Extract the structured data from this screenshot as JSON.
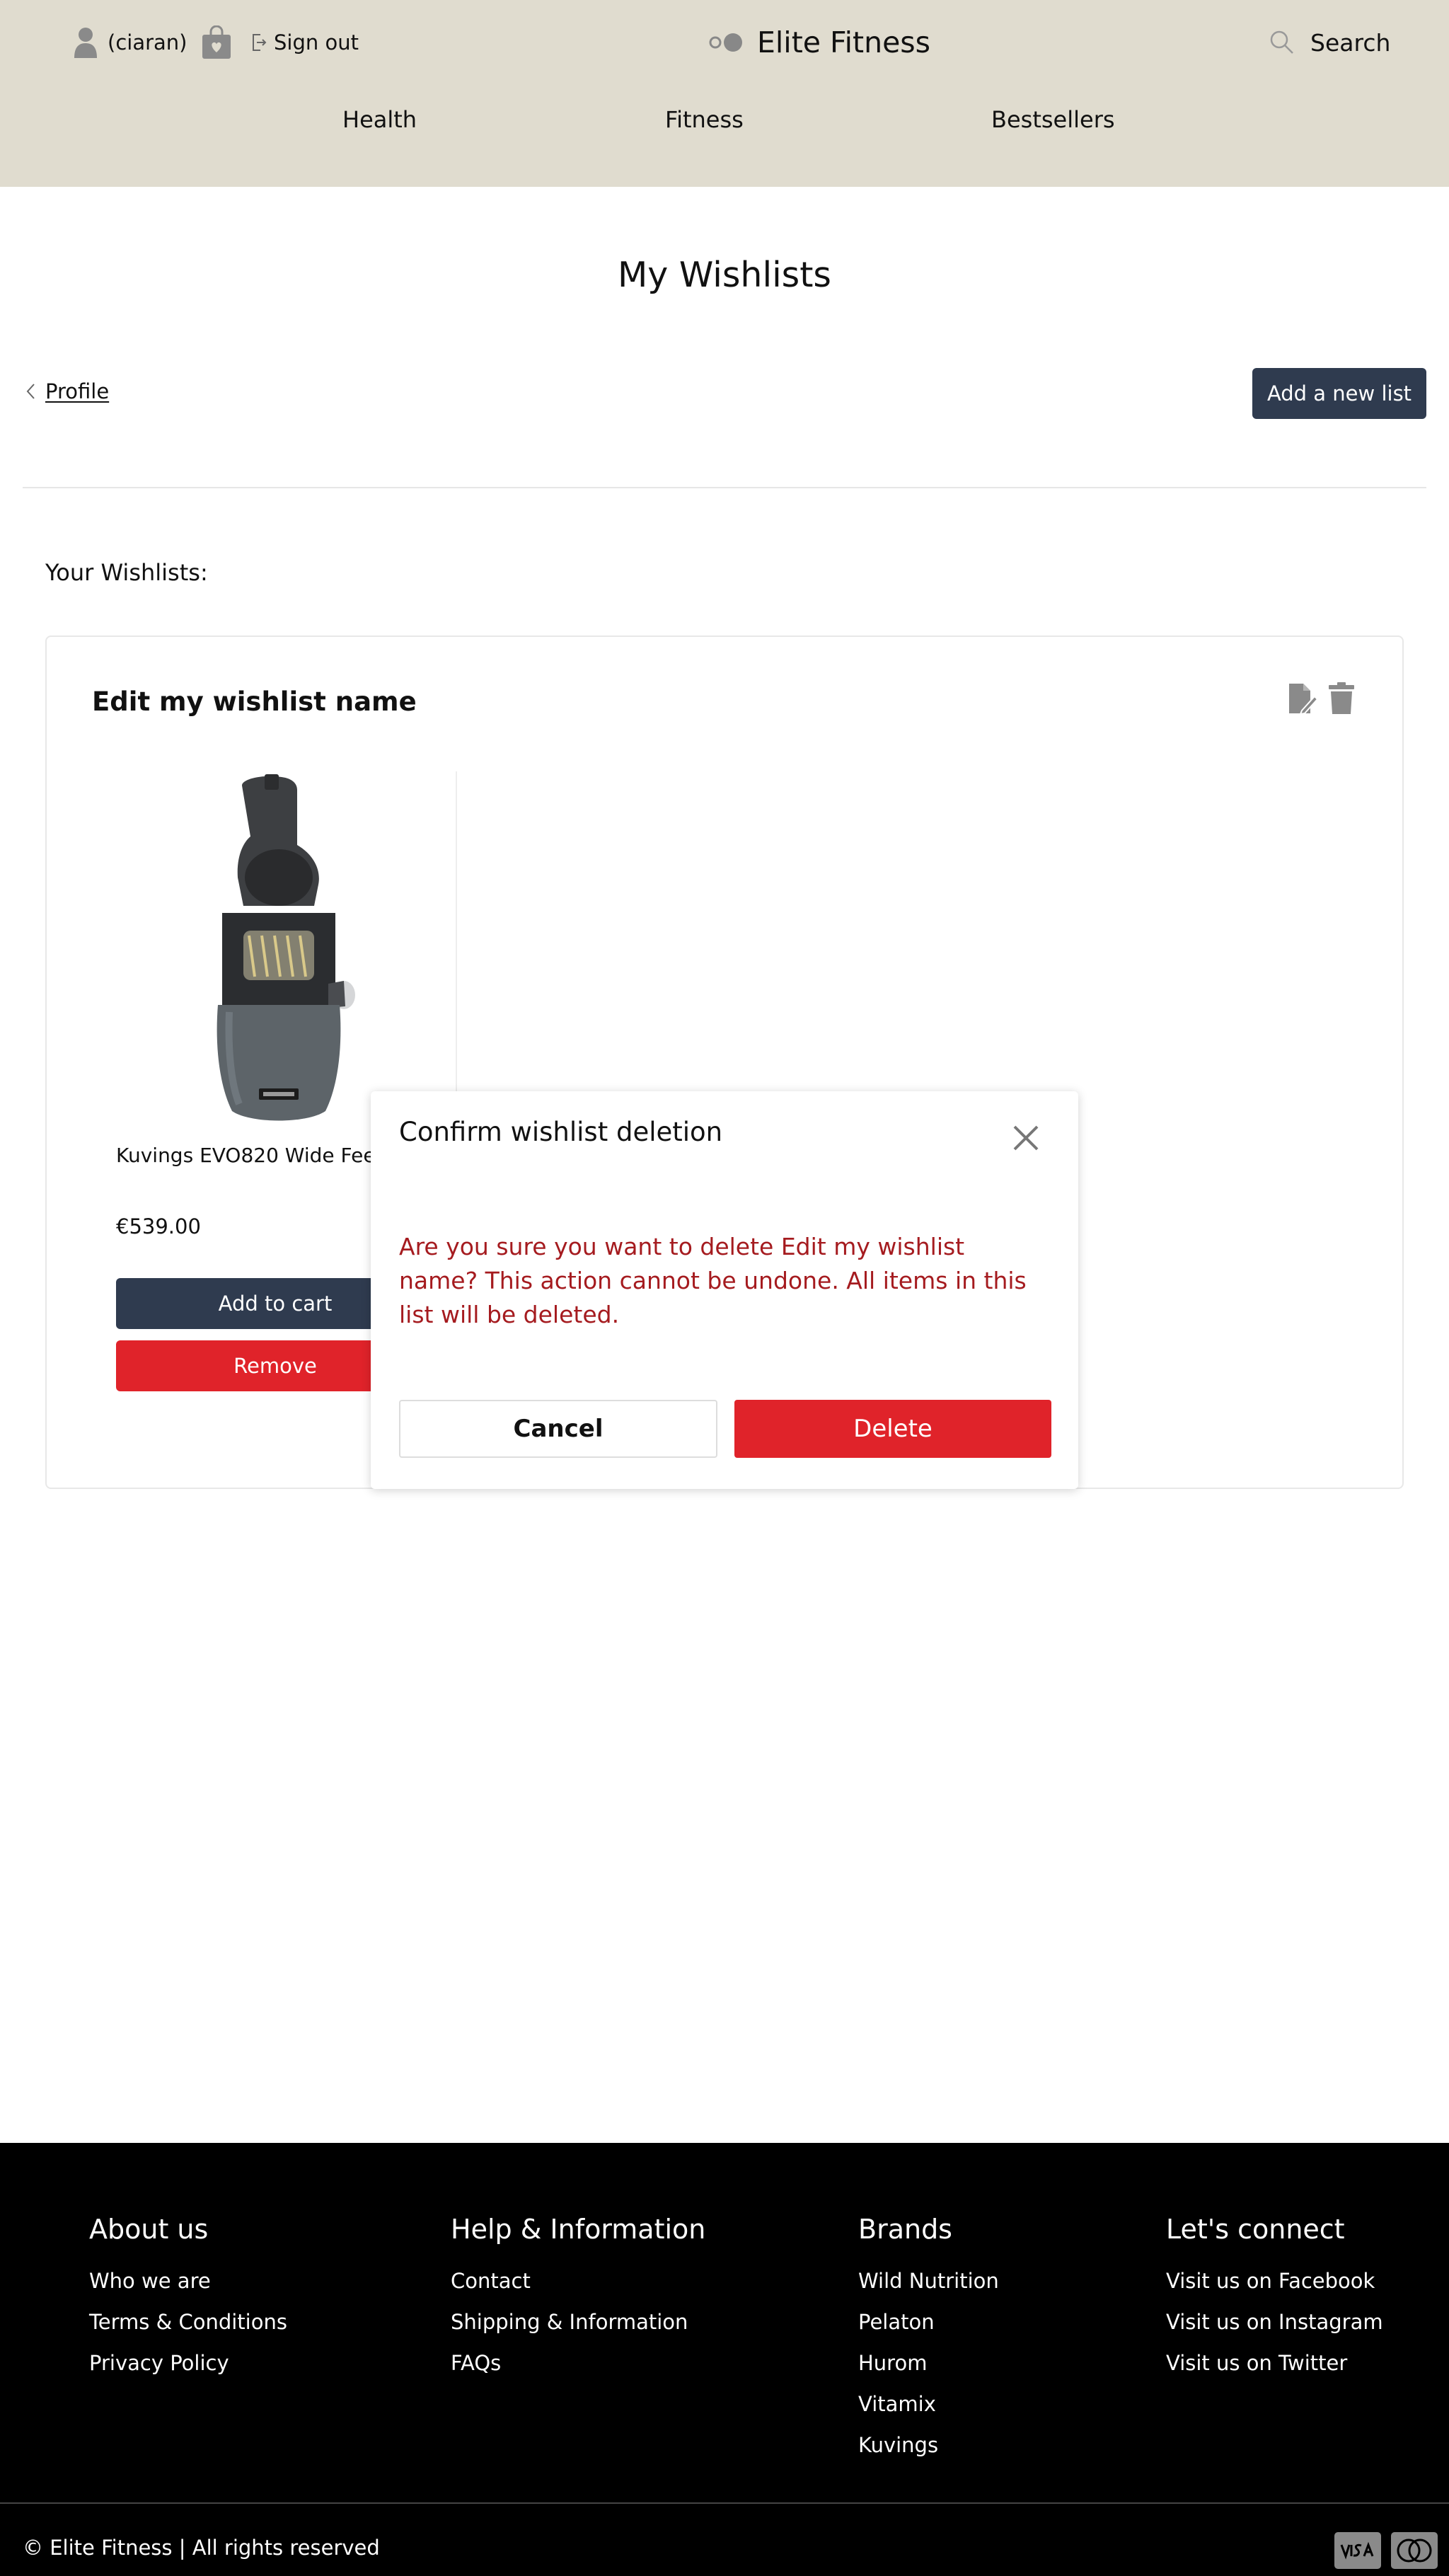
{
  "header": {
    "username": "(ciaran)",
    "signout_label": "Sign out",
    "brand": "Elite Fitness",
    "search_label": "Search",
    "nav": [
      "Health",
      "Fitness",
      "Bestsellers"
    ]
  },
  "page": {
    "title": "My Wishlists",
    "back_label": "Profile",
    "add_list_label": "Add a new list",
    "section_label": "Your Wishlists:"
  },
  "wishlist": {
    "name": "Edit my wishlist name",
    "products": [
      {
        "name": "Kuvings EVO820 Wide Feed Juicer in Gunmetal",
        "price": "€539.00",
        "add_to_cart_label": "Add to cart",
        "remove_label": "Remove"
      }
    ]
  },
  "modal": {
    "title": "Confirm wishlist deletion",
    "message": "Are you sure you want to delete Edit my wishlist name? This action cannot be undone. All items in this list will be deleted.",
    "cancel_label": "Cancel",
    "delete_label": "Delete"
  },
  "footer": {
    "columns": [
      {
        "heading": "About us",
        "links": [
          "Who we are",
          "Terms & Conditions",
          "Privacy Policy"
        ]
      },
      {
        "heading": "Help & Information",
        "links": [
          "Contact",
          "Shipping & Information",
          "FAQs"
        ]
      },
      {
        "heading": "Brands",
        "links": [
          "Wild Nutrition",
          "Pelaton",
          "Hurom",
          "Vitamix",
          "Kuvings"
        ]
      },
      {
        "heading": "Let's connect",
        "links": [
          "Visit us on Facebook",
          "Visit us on Instagram",
          "Visit us on Twitter"
        ]
      }
    ],
    "copyright": "© Elite Fitness | All rights reserved",
    "payment_icons": [
      "visa-icon",
      "mastercard-icon"
    ]
  },
  "colors": {
    "header_bg": "#e0dccf",
    "primary_button": "#2f3b4f",
    "danger": "#e0232a",
    "danger_text": "#a51b1f",
    "footer_bg": "#000000"
  }
}
